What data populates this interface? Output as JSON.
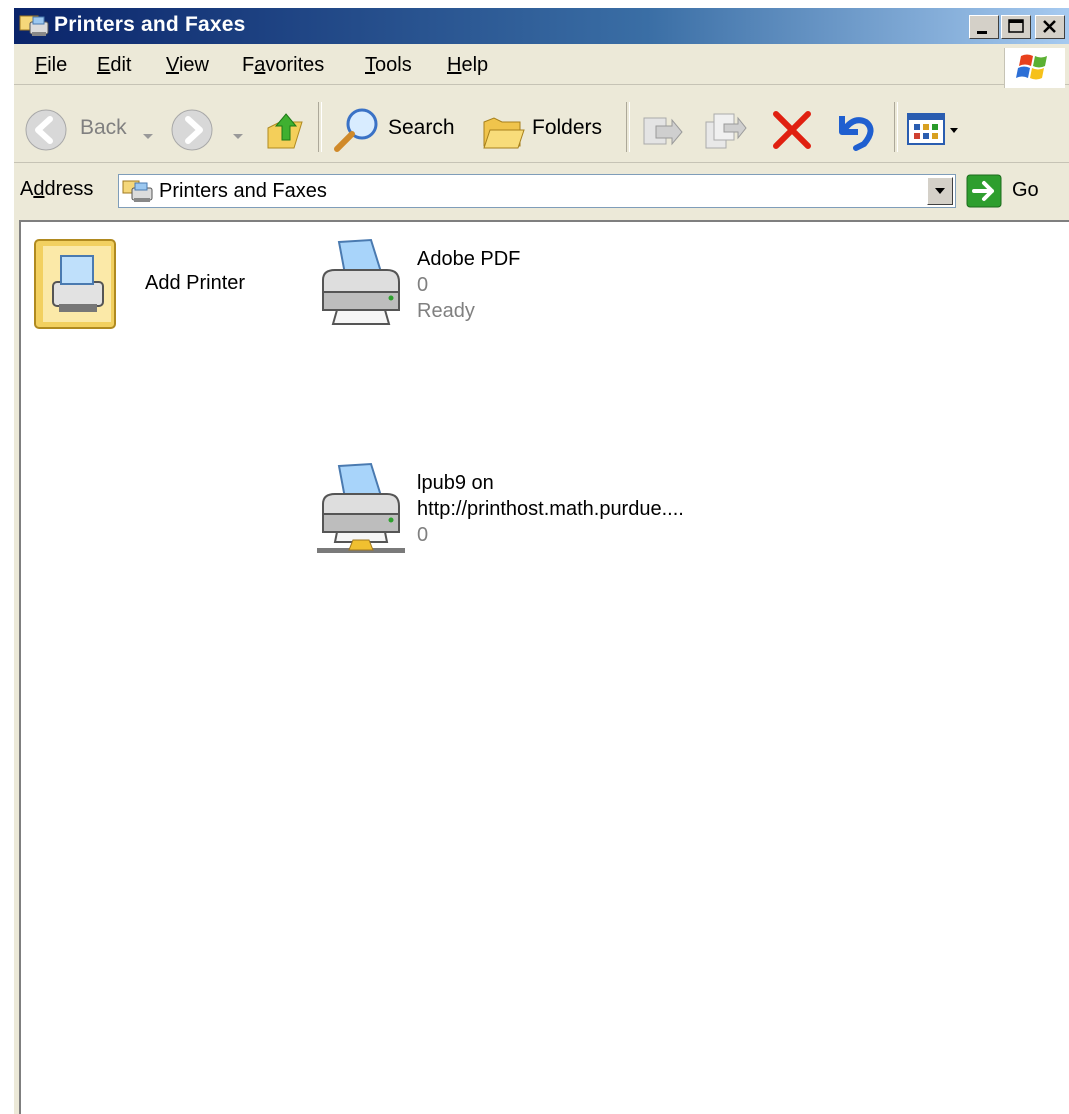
{
  "window": {
    "title": "Printers and Faxes",
    "caption_buttons": [
      "minimize",
      "maximize",
      "close"
    ]
  },
  "menu": {
    "items": [
      {
        "label": "File",
        "accel": "F",
        "rest": "ile"
      },
      {
        "label": "Edit",
        "accel": "E",
        "rest": "dit"
      },
      {
        "label": "View",
        "accel": "V",
        "rest": "iew"
      },
      {
        "label": "Favorites",
        "pre": "F",
        "accel": "a",
        "rest": "vorites"
      },
      {
        "label": "Tools",
        "accel": "T",
        "rest": "ools"
      },
      {
        "label": "Help",
        "accel": "H",
        "rest": "elp"
      }
    ]
  },
  "toolbar": {
    "back_label": "Back",
    "search_label": "Search",
    "folders_label": "Folders",
    "icons": [
      "back-icon",
      "forward-icon",
      "up-folder-icon",
      "search-icon",
      "folders-icon",
      "move-to-icon",
      "copy-to-icon",
      "delete-icon",
      "undo-icon",
      "views-icon"
    ]
  },
  "address": {
    "label_pre": "A",
    "label_accel": "d",
    "label_rest": "dress",
    "value": "Printers and Faxes",
    "go_label": "Go"
  },
  "items": [
    {
      "name": "Add Printer"
    },
    {
      "name": "Adobe PDF",
      "jobs": "0",
      "status": "Ready"
    },
    {
      "name_line1": "lpub9 on",
      "name_line2": "http://printhost.math.purdue....",
      "jobs": "0"
    }
  ],
  "colors": {
    "titlebar_start": "#0a246a",
    "titlebar_end": "#a6caf0",
    "chrome": "#ece9d8",
    "delete_red": "#e02010",
    "go_green": "#2e9e2e"
  }
}
